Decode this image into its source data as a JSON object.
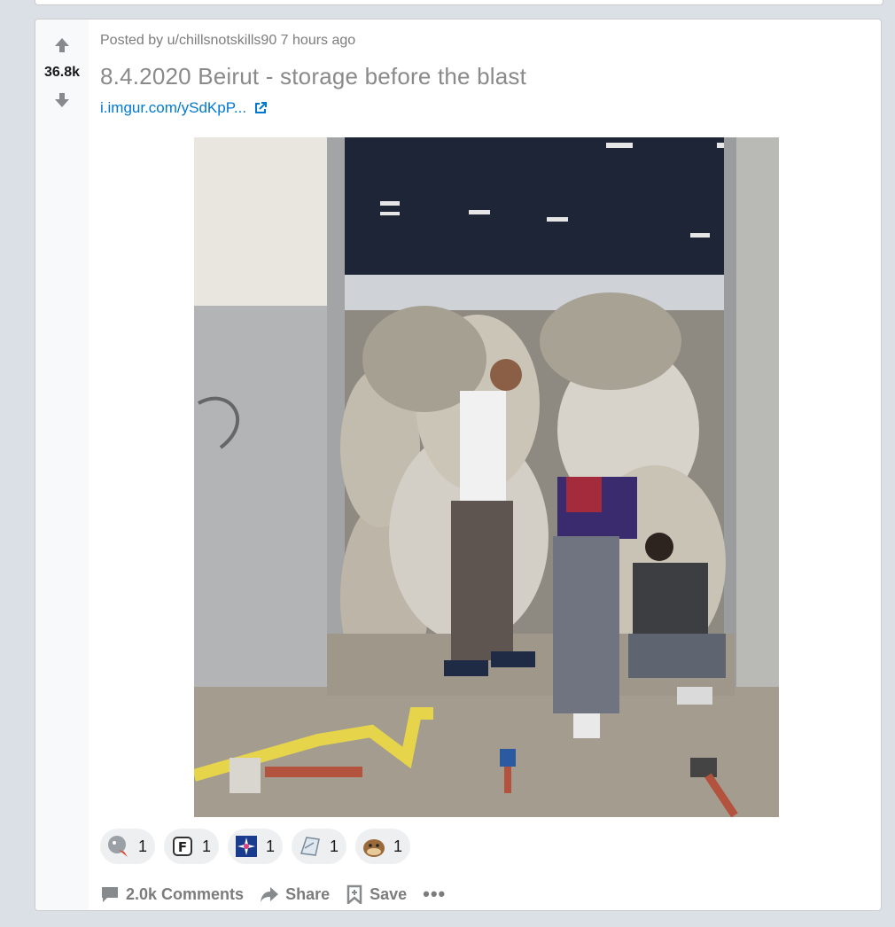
{
  "post": {
    "score": "36.8k",
    "posted_prefix": "Posted by",
    "author": "u/chillsnotskills90",
    "time": "7 hours ago",
    "title": "8.4.2020 Beirut - storage before the blast",
    "link_text": "i.imgur.com/ySdKpP...",
    "image_description_icon": "photo"
  },
  "awards": [
    {
      "icon": "award-1-icon",
      "count": "1"
    },
    {
      "icon": "award-2-icon",
      "count": "1"
    },
    {
      "icon": "award-3-icon",
      "count": "1"
    },
    {
      "icon": "award-4-icon",
      "count": "1"
    },
    {
      "icon": "award-5-icon",
      "count": "1"
    }
  ],
  "actions": {
    "comments": "2.0k Comments",
    "share": "Share",
    "save": "Save",
    "more": "•••"
  },
  "colors": {
    "page_bg": "#dae0e6",
    "card_bg": "#ffffff",
    "vote_bg": "#f8f9fa",
    "link": "#0079d3",
    "muted": "#7c7c7c",
    "title": "#8a8a8a"
  }
}
